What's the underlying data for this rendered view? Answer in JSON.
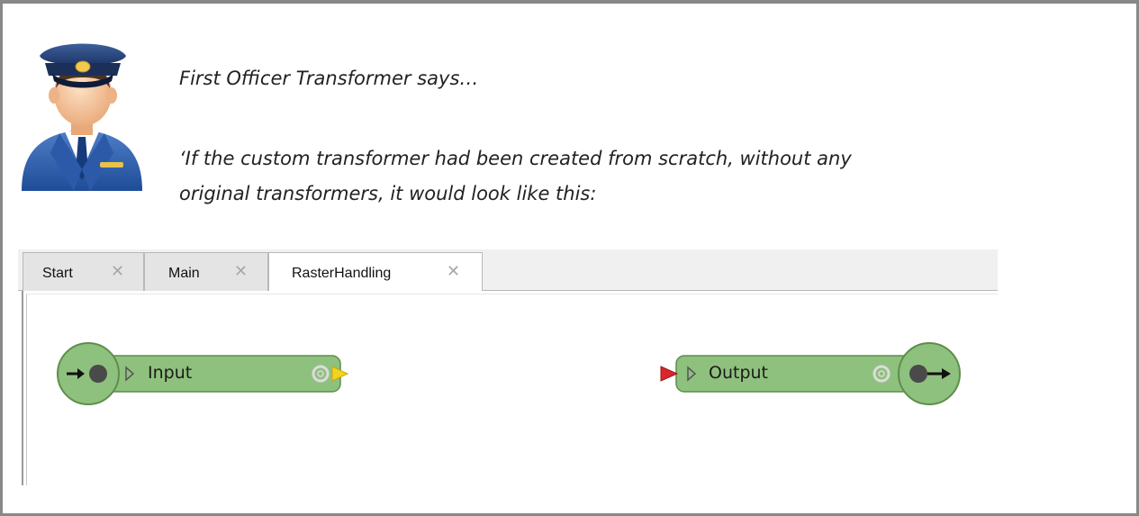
{
  "message": {
    "line1": "First Officer Transformer says…",
    "line2": "‘If the custom transformer had been created from scratch, without any",
    "line3": "original transformers, it would look like this:"
  },
  "tabs": [
    {
      "label": "Start",
      "close": "✕",
      "active": false
    },
    {
      "label": "Main",
      "close": "✕",
      "active": false
    },
    {
      "label": "RasterHandling",
      "close": "✕",
      "active": true
    }
  ],
  "nodes": {
    "input": {
      "label": "Input",
      "color": "#8fc17e",
      "port_color": "#f5d21b"
    },
    "output": {
      "label": "Output",
      "color": "#8fc17e",
      "port_color": "#d8262c"
    }
  }
}
